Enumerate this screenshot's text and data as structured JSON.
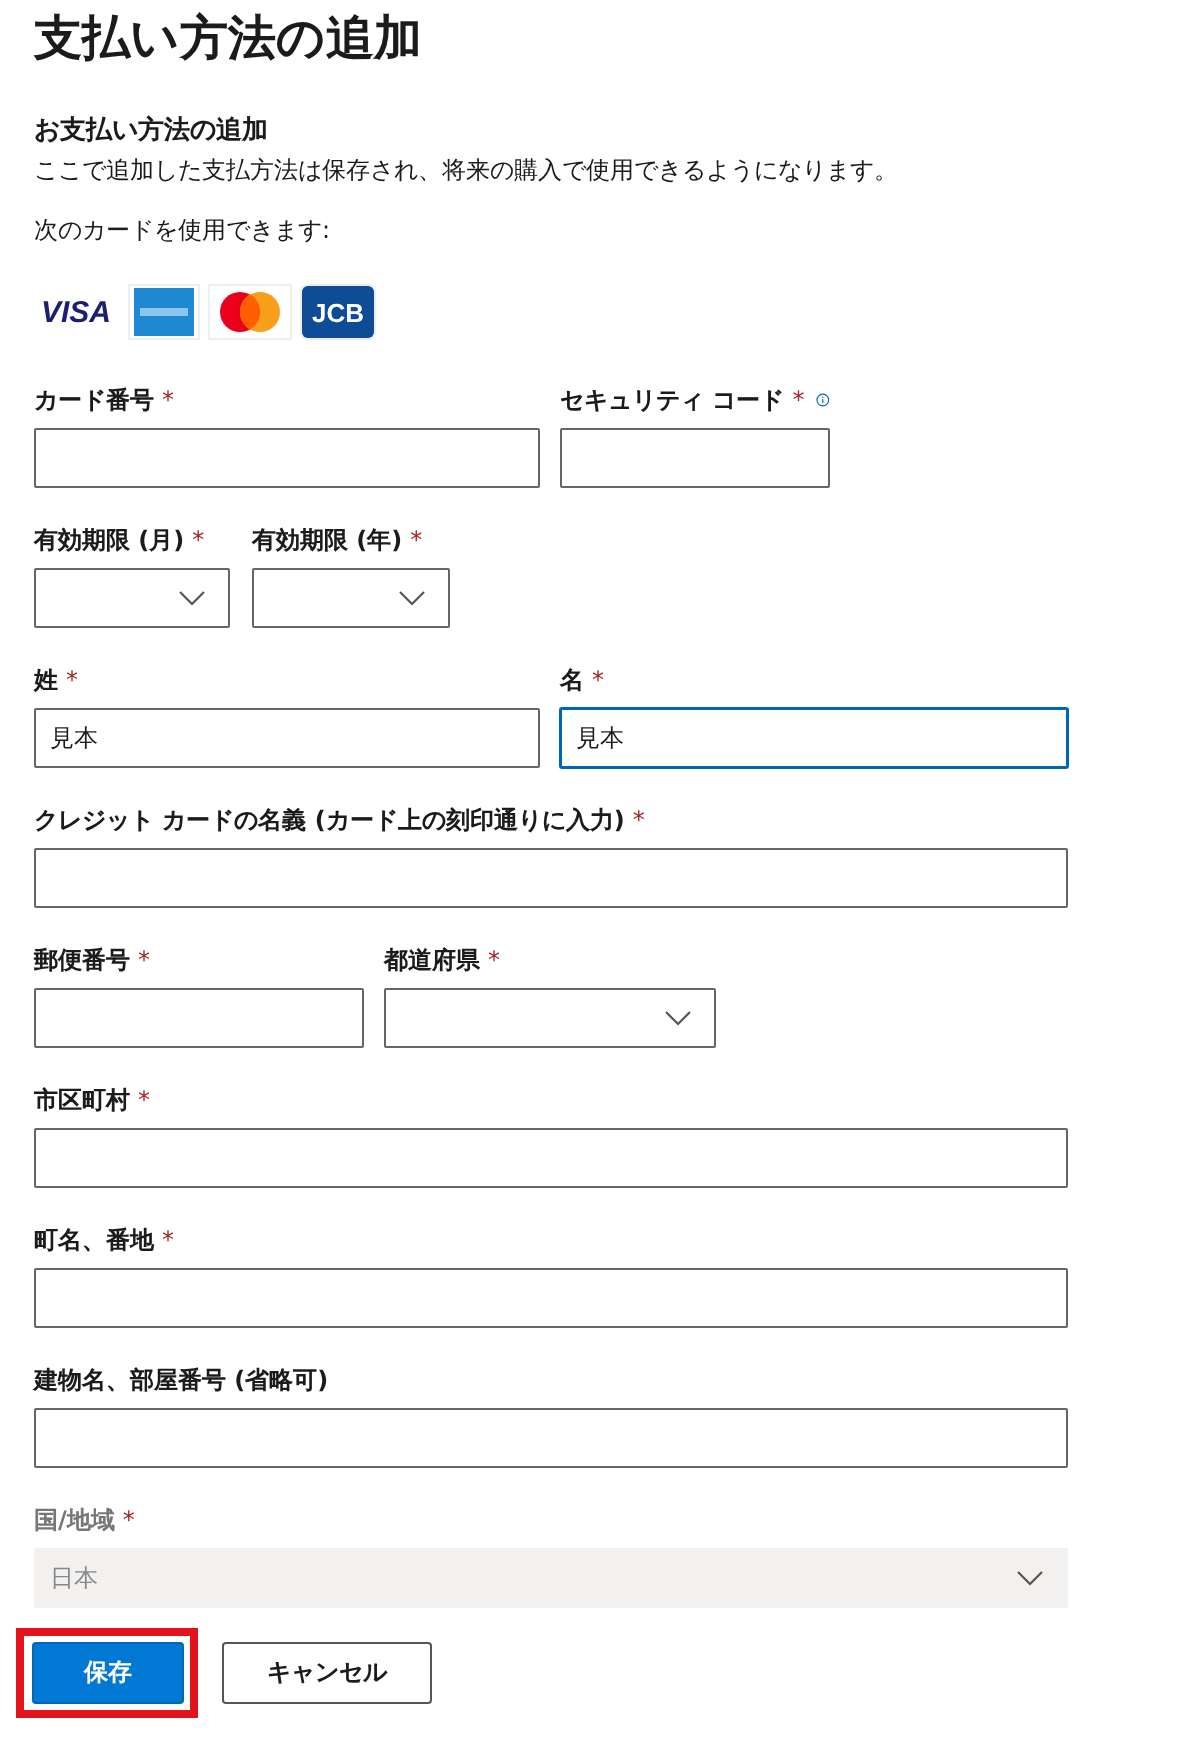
{
  "title": "支払い方法の追加",
  "subtitle": "お支払い方法の追加",
  "description": "ここで追加した支払方法は保存され、将来の購入で使用できるようになります。",
  "cards_label": "次のカードを使用できます:",
  "cards": [
    {
      "kind": "visa",
      "label": "VISA"
    },
    {
      "kind": "amex"
    },
    {
      "kind": "mastercard"
    },
    {
      "kind": "jcb",
      "label": "JCB"
    }
  ],
  "rows": [
    [
      {
        "label": "カード番号",
        "required_mark": "*",
        "kind": "text",
        "focused": false,
        "disabled": false
      },
      {
        "label": "セキュリティ コード",
        "required_mark": "*",
        "kind": "text",
        "info": true,
        "focused": false,
        "disabled": false
      }
    ],
    [
      {
        "label": "有効期限 (月)",
        "required_mark": "*",
        "kind": "select",
        "focused": false,
        "disabled": false
      },
      {
        "label": "有効期限 (年)",
        "required_mark": "*",
        "kind": "select",
        "focused": false,
        "disabled": false
      }
    ],
    [
      {
        "label": "姓",
        "required_mark": "*",
        "kind": "text",
        "value": "見本",
        "focused": false,
        "disabled": false
      },
      {
        "label": "名",
        "required_mark": "*",
        "kind": "text",
        "value": "見本",
        "focused": true,
        "disabled": false
      }
    ],
    [
      {
        "label": "クレジット カードの名義 (カード上の刻印通りに入力)",
        "required_mark": "*",
        "kind": "text",
        "focused": false,
        "disabled": false
      }
    ],
    [
      {
        "label": "郵便番号",
        "required_mark": "*",
        "kind": "text",
        "focused": false,
        "disabled": false
      },
      {
        "label": "都道府県",
        "required_mark": "*",
        "kind": "select",
        "focused": false,
        "disabled": false
      }
    ],
    [
      {
        "label": "市区町村",
        "required_mark": "*",
        "kind": "text",
        "focused": false,
        "disabled": false
      }
    ],
    [
      {
        "label": "町名、番地",
        "required_mark": "*",
        "kind": "text",
        "focused": false,
        "disabled": false
      }
    ],
    [
      {
        "label": "建物名、部屋番号 (省略可)",
        "kind": "text",
        "focused": false,
        "disabled": false
      }
    ],
    [
      {
        "label": "国/地域",
        "required_mark": "*",
        "kind": "select",
        "value": "日本",
        "focused": false,
        "disabled": true
      }
    ]
  ],
  "buttons": [
    {
      "label": "保存",
      "kind": "primary",
      "highlighted": true
    },
    {
      "label": "キャンセル",
      "kind": "secondary",
      "highlighted": false
    }
  ]
}
